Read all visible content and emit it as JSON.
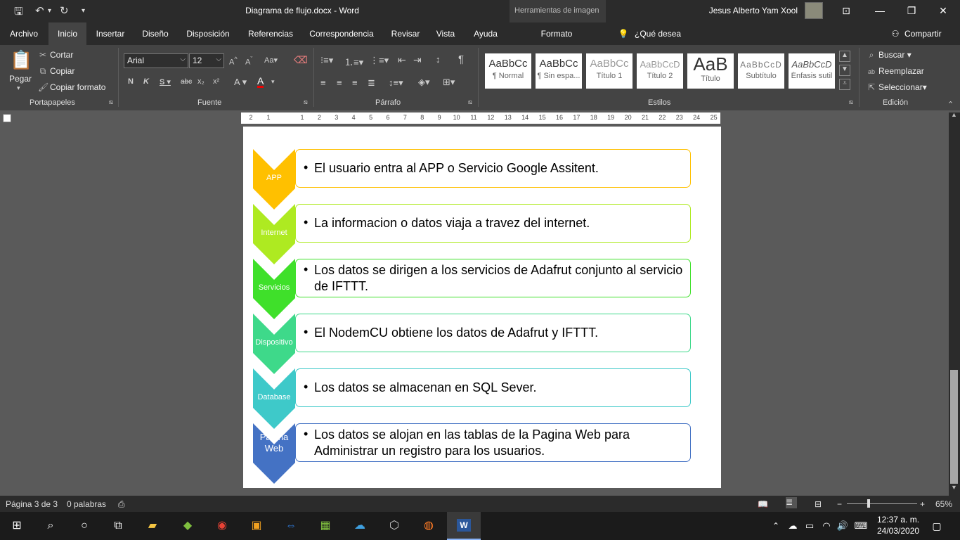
{
  "titlebar": {
    "document": "Diagrama de flujo.docx  -  Word",
    "context_tools": "Herramientas de imagen",
    "user": "Jesus Alberto Yam Xool"
  },
  "tabs": [
    "Archivo",
    "Inicio",
    "Insertar",
    "Diseño",
    "Disposición",
    "Referencias",
    "Correspondencia",
    "Revisar",
    "Vista",
    "Ayuda",
    "Formato"
  ],
  "tell_me": "¿Qué desea hacer?",
  "share": "Compartir",
  "clipboard": {
    "paste": "Pegar",
    "cut": "Cortar",
    "copy": "Copiar",
    "format_painter": "Copiar formato",
    "label": "Portapapeles"
  },
  "font": {
    "name": "Arial",
    "size": "12",
    "label": "Fuente"
  },
  "paragraph": {
    "label": "Párrafo"
  },
  "styles": {
    "label": "Estilos",
    "items": [
      {
        "sample": "AaBbCc",
        "name": "¶ Normal"
      },
      {
        "sample": "AaBbCc",
        "name": "¶ Sin espa..."
      },
      {
        "sample": "AaBbCc",
        "name": "Título 1"
      },
      {
        "sample": "AaBbCcD",
        "name": "Título 2"
      },
      {
        "sample": "AaB",
        "name": "Título"
      },
      {
        "sample": "AaBbCcD",
        "name": "Subtítulo"
      },
      {
        "sample": "AaBbCcD",
        "name": "Énfasis sutil"
      }
    ]
  },
  "editing": {
    "find": "Buscar",
    "replace": "Reemplazar",
    "select": "Seleccionar",
    "label": "Edición"
  },
  "ruler": [
    "2",
    "1",
    "1",
    "2",
    "3",
    "4",
    "5",
    "6",
    "7",
    "8",
    "9",
    "10",
    "11",
    "12",
    "13",
    "14",
    "15",
    "16",
    "17",
    "18",
    "19",
    "20",
    "21",
    "22",
    "23",
    "24",
    "25"
  ],
  "diagram": [
    {
      "label": "APP",
      "text": "El usuario entra al APP o Servicio Google Assitent.",
      "color": "#FFC000"
    },
    {
      "label": "Internet",
      "text": "La informacion o datos viaja a travez del internet.",
      "color": "#AEEA21"
    },
    {
      "label": "Servicios",
      "text": "Los datos se dirigen a los servicios de Adafrut conjunto al servicio de IFTTT.",
      "color": "#3FE02A"
    },
    {
      "label": "Dispositivo",
      "text": "El NodemCU obtiene los datos de Adafrut y IFTTT.",
      "color": "#3ED98A"
    },
    {
      "label": "Database",
      "text": "Los datos se almacenan en SQL Sever.",
      "color": "#3EC9C9"
    },
    {
      "label": "Pagina Web",
      "text": "Los datos se alojan en las tablas de la Pagina Web para Administrar un registro para los usuarios.",
      "color": "#4472C4"
    }
  ],
  "status": {
    "page": "Página 3 de 3",
    "words": "0 palabras",
    "zoom": "65%"
  },
  "clock": {
    "time": "12:37 a. m.",
    "date": "24/03/2020"
  }
}
